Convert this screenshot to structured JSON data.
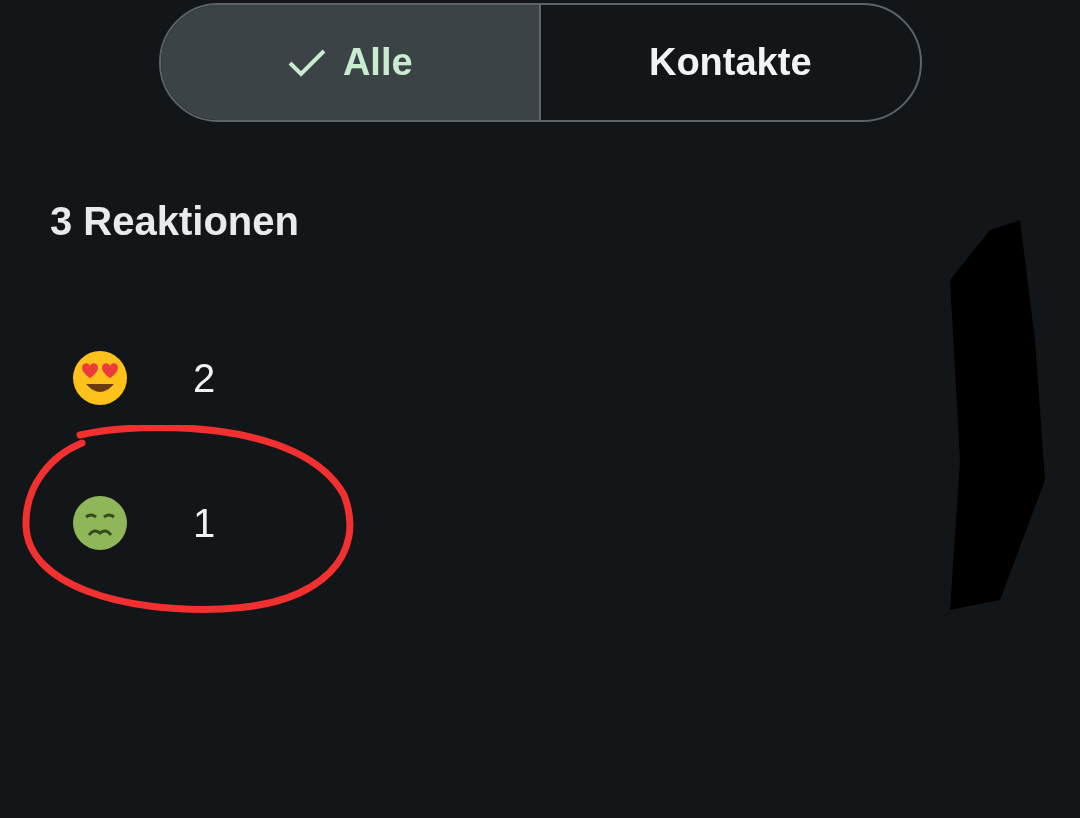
{
  "filters": [
    {
      "label": "Alle",
      "selected": true
    },
    {
      "label": "Kontakte",
      "selected": false
    }
  ],
  "heading": "3 Reaktionen",
  "reactions": [
    {
      "kind": "heart-eyes",
      "count": "2"
    },
    {
      "kind": "nauseated",
      "count": "1"
    }
  ]
}
